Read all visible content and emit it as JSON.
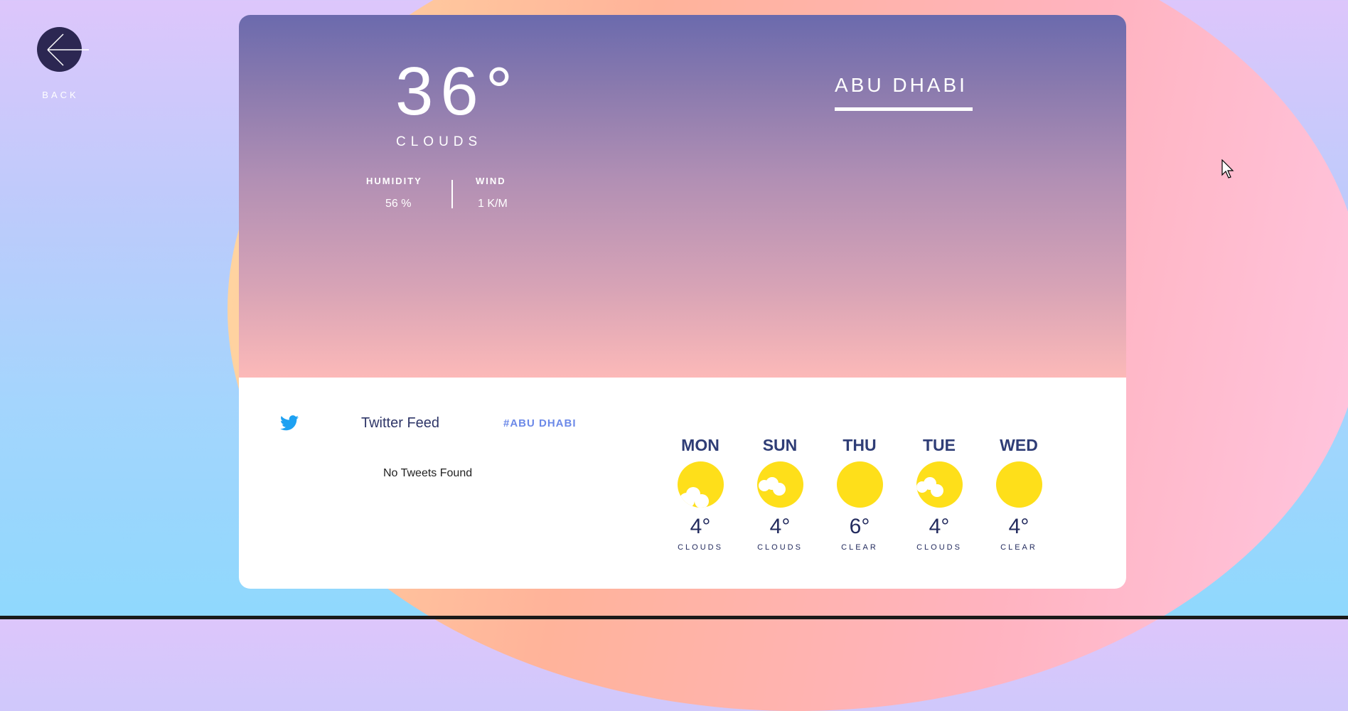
{
  "nav": {
    "back_label": "BACK"
  },
  "weather": {
    "temperature": "36°",
    "condition": "CLOUDS",
    "humidity_label": "HUMIDITY",
    "humidity_value": "56 %",
    "wind_label": "WIND",
    "wind_value": "1 K/M",
    "city": "ABU DHABI"
  },
  "feed": {
    "title": "Twitter Feed",
    "hashtag": "#ABU DHABI",
    "empty_message": "No Tweets Found"
  },
  "forecast": [
    {
      "day": "MON",
      "temp": "4°",
      "condition": "CLOUDS",
      "icon": "sun-cloud-icon"
    },
    {
      "day": "SUN",
      "temp": "4°",
      "condition": "CLOUDS",
      "icon": "sun-cloud-icon"
    },
    {
      "day": "THU",
      "temp": "6°",
      "condition": "CLEAR",
      "icon": "sun-icon"
    },
    {
      "day": "TUE",
      "temp": "4°",
      "condition": "CLOUDS",
      "icon": "sun-cloud-icon"
    },
    {
      "day": "WED",
      "temp": "4°",
      "condition": "CLEAR",
      "icon": "sun-icon"
    }
  ],
  "colors": {
    "sun": "#fedf1a",
    "accent_text": "#2f3d76",
    "hashtag": "#6c89e8",
    "twitter_blue": "#1da1f2",
    "back_button": "#2c2752"
  },
  "icons": {
    "back": "arrow-left-icon",
    "twitter": "twitter-bird-icon",
    "cursor": "mouse-pointer-icon"
  }
}
